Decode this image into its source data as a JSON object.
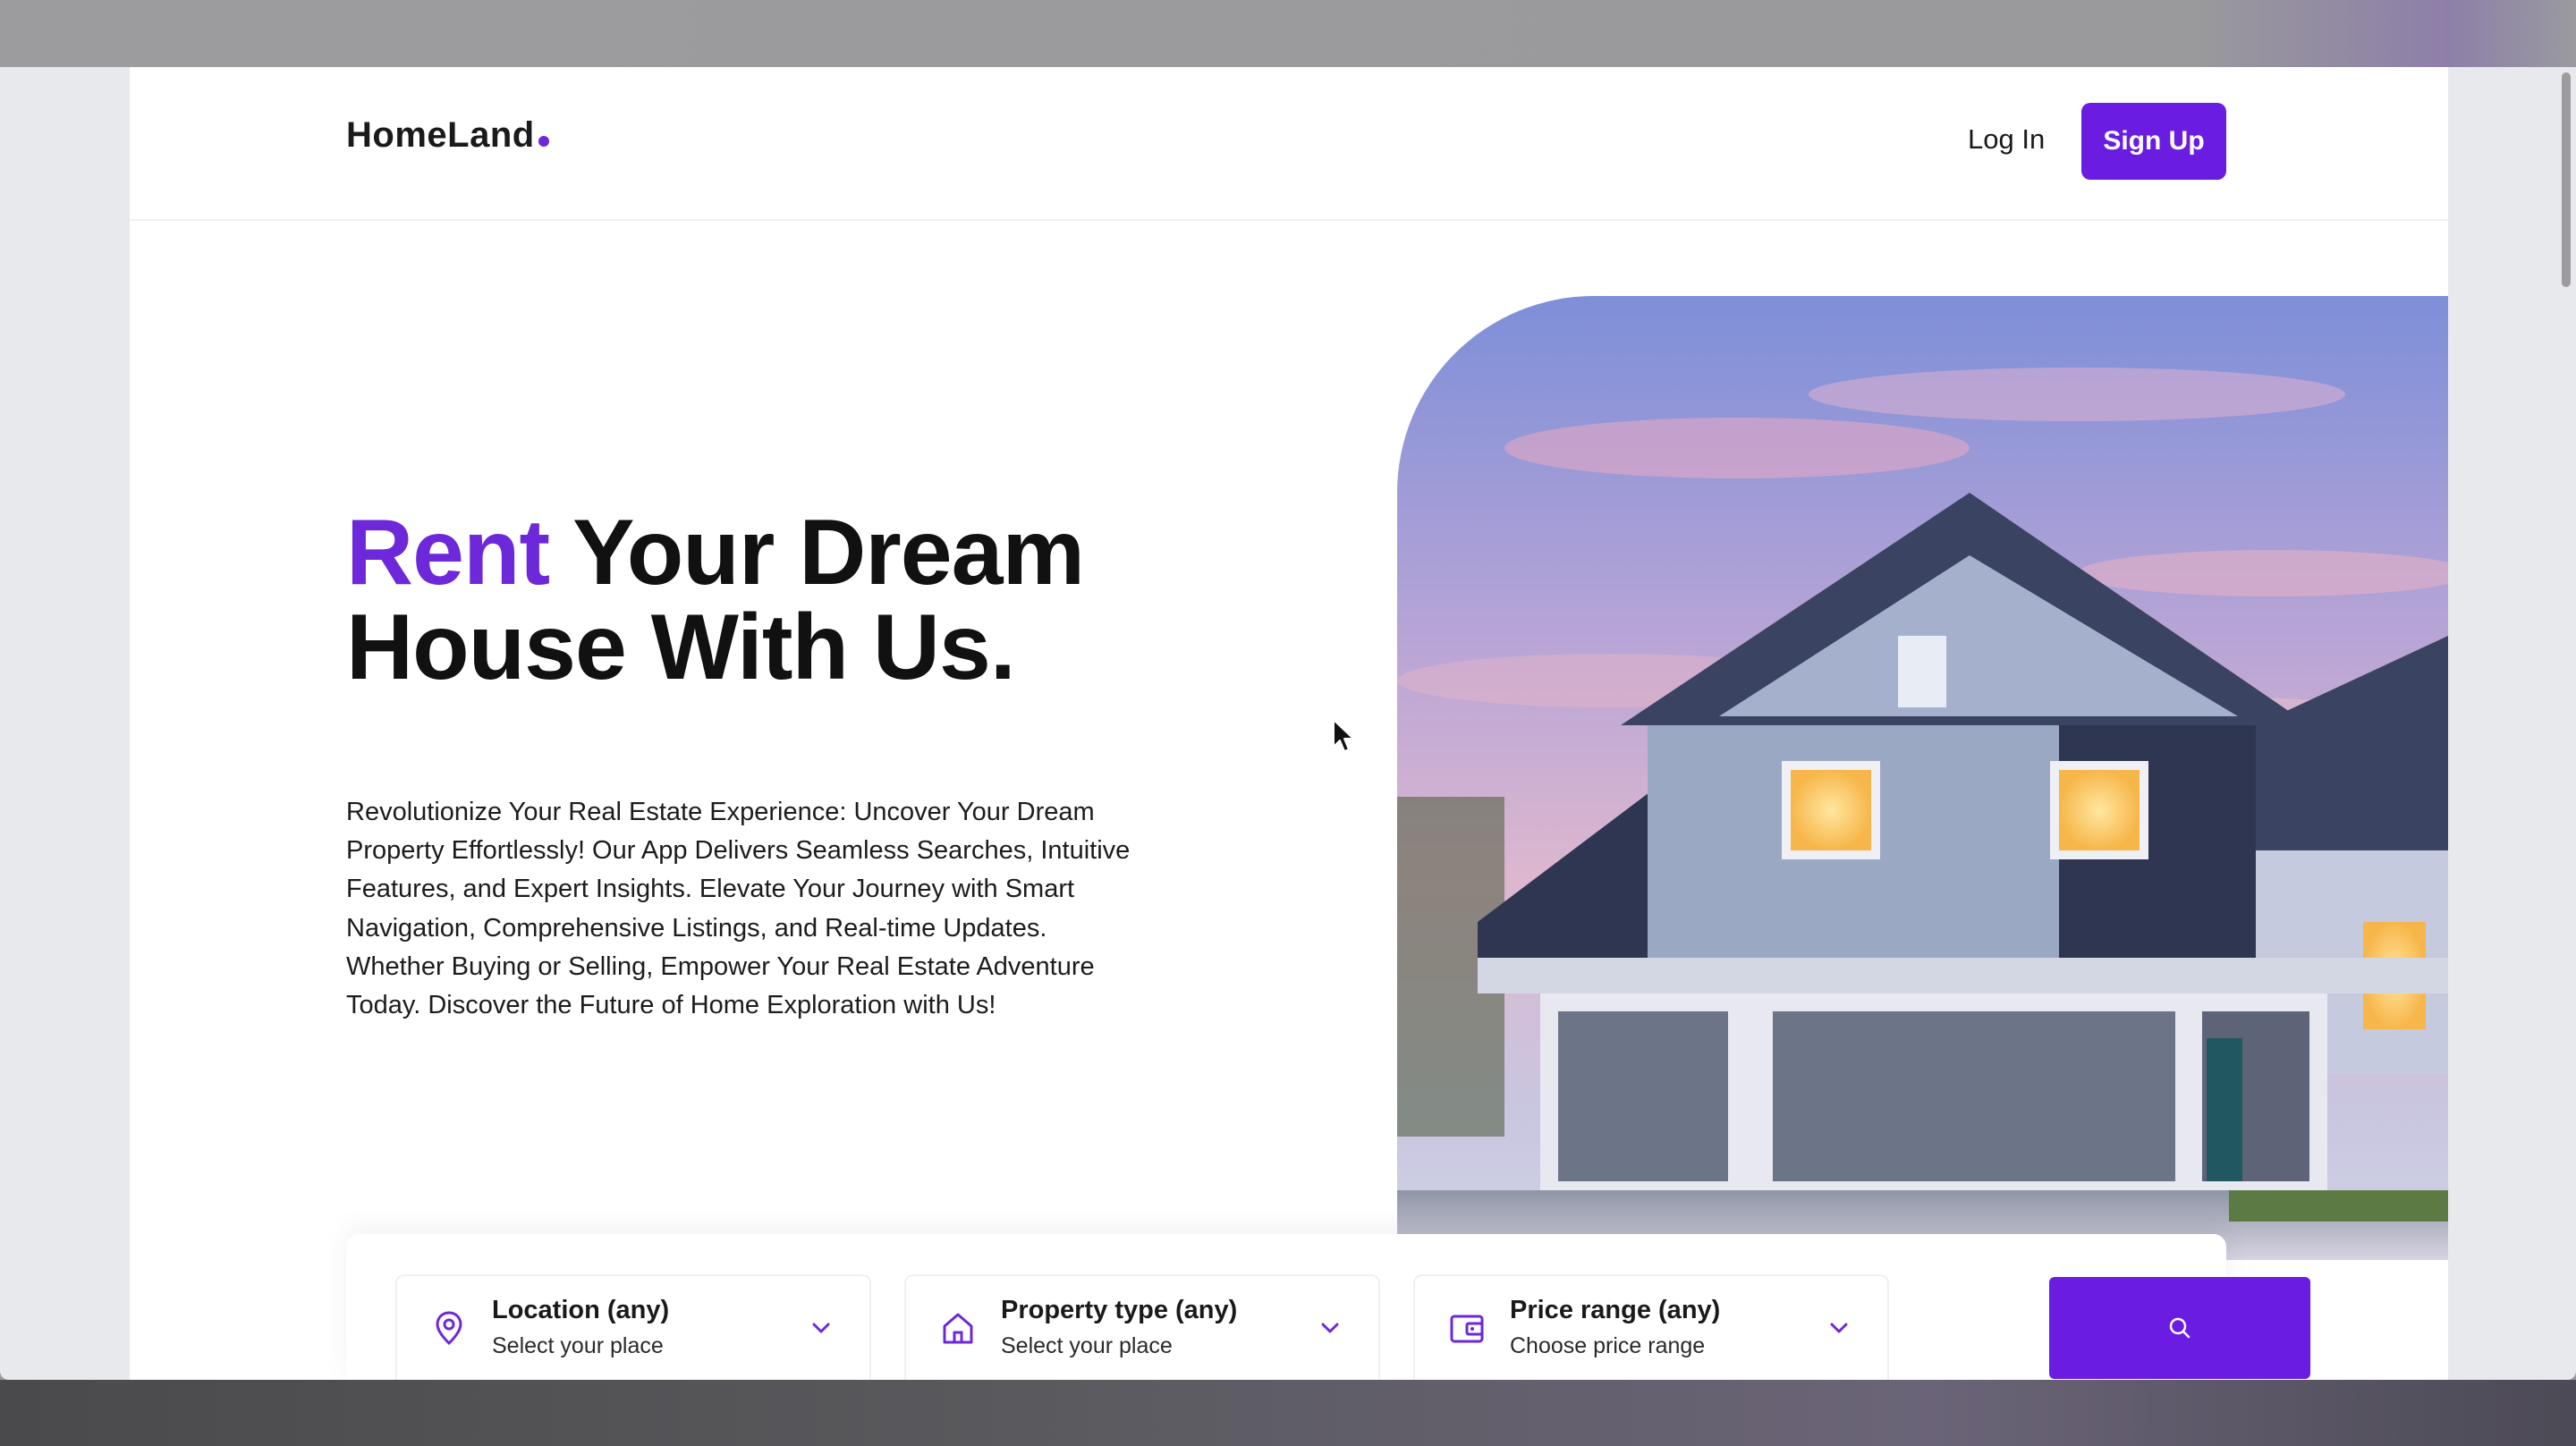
{
  "header": {
    "logo": "HomeLand",
    "login_label": "Log In",
    "signup_label": "Sign Up"
  },
  "hero": {
    "title_accent": "Rent",
    "title_rest_line1": " Your Dream",
    "title_line2": "House With Us.",
    "description": "Revolutionize Your Real Estate Experience: Uncover Your Dream Property Effortlessly! Our App Delivers Seamless Searches, Intuitive Features, and Expert Insights. Elevate Your Journey with Smart Navigation, Comprehensive Listings, and Real-time Updates. Whether Buying or Selling, Empower Your Real Estate Adventure Today. Discover the Future of Home Exploration with Us!"
  },
  "search": {
    "fields": [
      {
        "title": "Location (any)",
        "subtitle": "Select your place",
        "icon": "location-pin-icon"
      },
      {
        "title": "Property type (any)",
        "subtitle": "Select your place",
        "icon": "house-icon"
      },
      {
        "title": "Price range (any)",
        "subtitle": "Choose price range",
        "icon": "wallet-icon"
      }
    ],
    "button_icon": "search-icon"
  },
  "colors": {
    "accent": "#6d28d9",
    "button": "#6a1de0",
    "text": "#111111"
  }
}
